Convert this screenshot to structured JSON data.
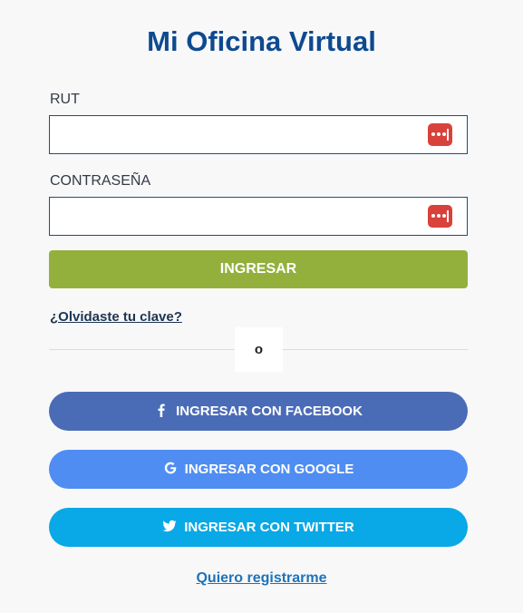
{
  "page": {
    "title": "Mi Oficina Virtual"
  },
  "form": {
    "rut": {
      "label": "RUT",
      "value": "",
      "placeholder": ""
    },
    "password": {
      "label": "CONTRASEÑA",
      "value": "",
      "placeholder": ""
    },
    "password_manager_icon": "password-manager-icon",
    "submit_label": "INGRESAR",
    "forgot_label": "¿Olvidaste tu clave?",
    "separator_label": "o"
  },
  "social": {
    "facebook": {
      "label": "INGRESAR CON FACEBOOK",
      "icon": "facebook-icon",
      "color": "#4a6cb7"
    },
    "google": {
      "label": "INGRESAR CON GOOGLE",
      "icon": "google-icon",
      "color": "#4f8df2"
    },
    "twitter": {
      "label": "INGRESAR CON TWITTER",
      "icon": "twitter-icon",
      "color": "#09a8e6"
    }
  },
  "footer": {
    "register_label": "Quiero registrarme"
  },
  "colors": {
    "title": "#0d4a8f",
    "primary_button": "#93b03d",
    "password_icon": "#d9413b",
    "register_link": "#1e73b8"
  }
}
